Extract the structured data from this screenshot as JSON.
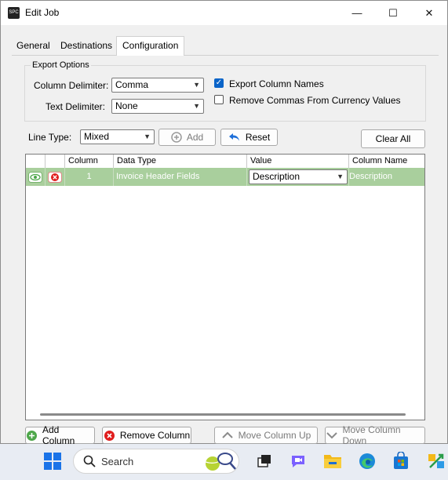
{
  "window": {
    "title": "Edit Job",
    "app_icon_text": "SPC",
    "controls": {
      "minimize": "—",
      "maximize": "☐",
      "close": "✕"
    }
  },
  "tabs": [
    {
      "label": "General",
      "active": false
    },
    {
      "label": "Destinations",
      "active": false
    },
    {
      "label": "Configuration",
      "active": true
    }
  ],
  "export_options": {
    "group_title": "Export Options",
    "column_delimiter_label": "Column Delimiter:",
    "column_delimiter_value": "Comma",
    "text_delimiter_label": "Text Delimiter:",
    "text_delimiter_value": "None",
    "export_column_names_label": "Export Column Names",
    "export_column_names_checked": true,
    "remove_commas_label": "Remove Commas From Currency Values",
    "remove_commas_checked": false
  },
  "line_type": {
    "label": "Line Type:",
    "value": "Mixed",
    "add_label": "Add",
    "reset_label": "Reset",
    "clear_all_label": "Clear All"
  },
  "grid": {
    "headers": [
      "",
      "",
      "Column",
      "Data Type",
      "Value",
      "Column Name"
    ],
    "rows": [
      {
        "column": "1",
        "data_type": "Invoice Header Fields",
        "value": "Description",
        "column_name": "Description"
      }
    ],
    "row_color": "#a9cf9d"
  },
  "bottom_buttons": {
    "add_column": "Add Column",
    "remove_column": "Remove Column",
    "move_up": "Move Column Up",
    "move_down": "Move Column Down"
  },
  "taskbar": {
    "search_placeholder": "Search",
    "icons": [
      "windows-start-icon",
      "search-icon",
      "widget-icon",
      "task-view-icon",
      "chat-icon",
      "file-explorer-icon",
      "edge-icon",
      "store-icon",
      "app-icon"
    ]
  },
  "colors": {
    "accent": "#0a64c8",
    "grid_row": "#a9cf9d",
    "add_icon": "#4ea74a",
    "remove_icon": "#e01c1c",
    "reset_icon": "#1e6fd9"
  }
}
